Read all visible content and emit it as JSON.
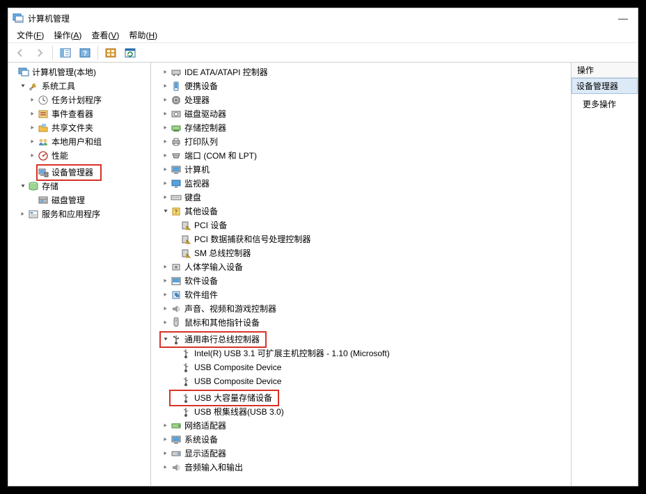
{
  "title": "计算机管理",
  "minimize": "—",
  "menu": [
    {
      "label": "文件",
      "accel": "F"
    },
    {
      "label": "操作",
      "accel": "A"
    },
    {
      "label": "查看",
      "accel": "V"
    },
    {
      "label": "帮助",
      "accel": "H"
    }
  ],
  "nav": {
    "root": "计算机管理(本地)",
    "sysTools": "系统工具",
    "taskSched": "任务计划程序",
    "eventViewer": "事件查看器",
    "sharedFolders": "共享文件夹",
    "localUsers": "本地用户和组",
    "performance": "性能",
    "deviceManager": "设备管理器",
    "storage": "存储",
    "diskMgmt": "磁盘管理",
    "services": "服务和应用程序"
  },
  "dev": {
    "ide": "IDE ATA/ATAPI 控制器",
    "portable": "便携设备",
    "processors": "处理器",
    "diskDrives": "磁盘驱动器",
    "storageControllers": "存储控制器",
    "printQueues": "打印队列",
    "ports": "端口 (COM 和 LPT)",
    "computer": "计算机",
    "monitors": "监视器",
    "keyboards": "键盘",
    "other": "其他设备",
    "otherPci": "PCI 设备",
    "otherPciData": "PCI 数据捕获和信号处理控制器",
    "otherSm": "SM 总线控制器",
    "hid": "人体学输入设备",
    "software": "软件设备",
    "softwareComp": "软件组件",
    "sound": "声音、视频和游戏控制器",
    "mice": "鼠标和其他指针设备",
    "usb": "通用串行总线控制器",
    "usbIntel": "Intel(R) USB 3.1 可扩展主机控制器 - 1.10 (Microsoft)",
    "usbComposite1": "USB Composite Device",
    "usbComposite2": "USB Composite Device",
    "usbMass": "USB 大容量存储设备",
    "usbRoot": "USB 根集线器(USB 3.0)",
    "netAdapters": "网络适配器",
    "systemDevices": "系统设备",
    "displayAdapters": "显示适配器",
    "audioIO": "音频输入和输出"
  },
  "actions": {
    "header": "操作",
    "selected": "设备管理器",
    "more": "更多操作"
  }
}
